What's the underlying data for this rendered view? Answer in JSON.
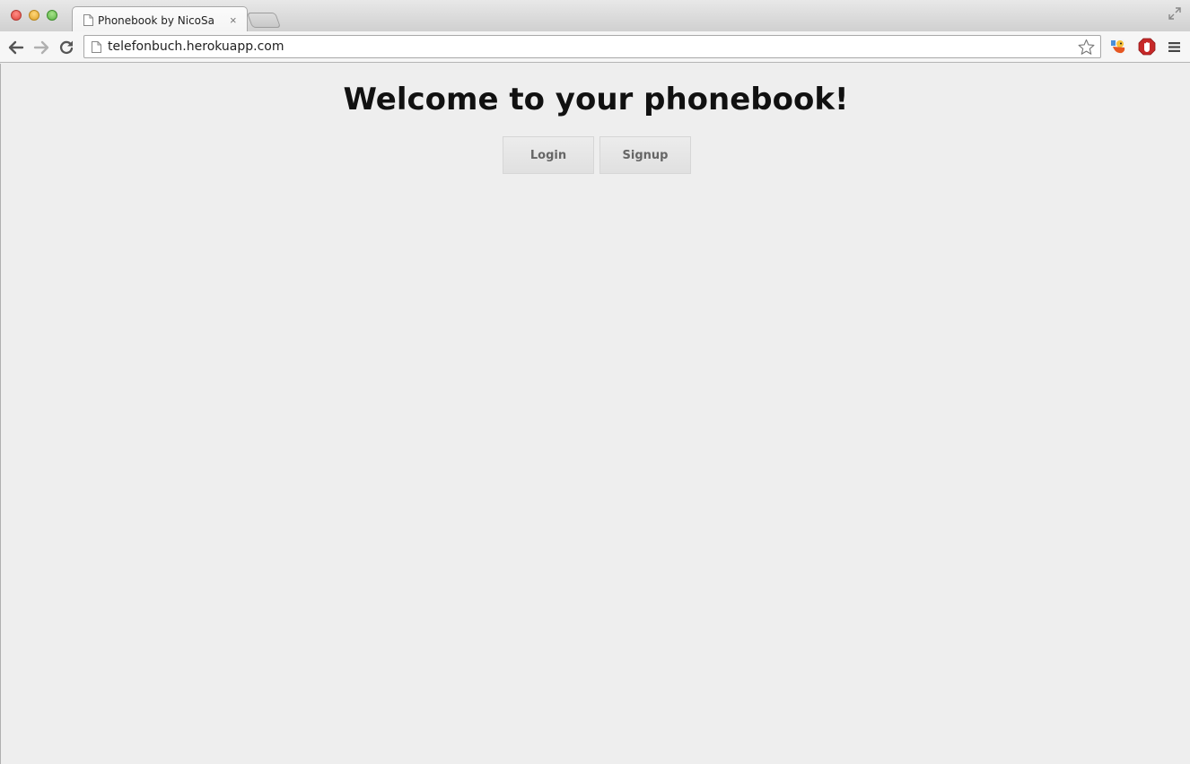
{
  "browser": {
    "tab_title": "Phonebook by NicoSa",
    "tab_close": "×",
    "url": "telefonbuch.herokuapp.com"
  },
  "page": {
    "heading": "Welcome to your phonebook!",
    "login_label": "Login",
    "signup_label": "Signup"
  },
  "colors": {
    "page_background": "#eeeeee",
    "button_background": "#e4e4e4",
    "button_text": "#666666"
  }
}
